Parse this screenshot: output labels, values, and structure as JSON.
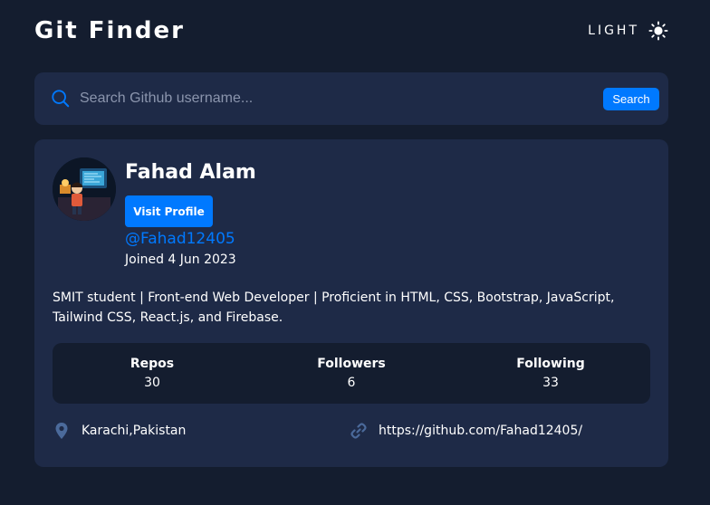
{
  "app": {
    "title": "Git Finder",
    "theme_toggle_label": "LIGHT",
    "theme_icon": "sun-icon"
  },
  "search": {
    "placeholder": "Search Github username...",
    "value": "",
    "button_label": "Search",
    "icon": "search-icon"
  },
  "profile": {
    "name": "Fahad Alam",
    "visit_button_label": "Visit Profile",
    "username": "@Fahad12405",
    "joined": "Joined 4 Jun 2023",
    "bio": "SMIT student | Front-end Web Developer | Proficient in HTML, CSS, Bootstrap, JavaScript, Tailwind CSS, React.js, and Firebase.",
    "stats": [
      {
        "label": "Repos",
        "value": "30"
      },
      {
        "label": "Followers",
        "value": "6"
      },
      {
        "label": "Following",
        "value": "33"
      }
    ],
    "location": "Karachi,Pakistan",
    "location_icon": "location-pin-icon",
    "blog": "https://github.com/Fahad12405/",
    "blog_icon": "link-icon"
  },
  "colors": {
    "background": "#141d2f",
    "card": "#1e2a47",
    "accent": "#0079ff",
    "muted_icon": "#4b6a9b"
  }
}
